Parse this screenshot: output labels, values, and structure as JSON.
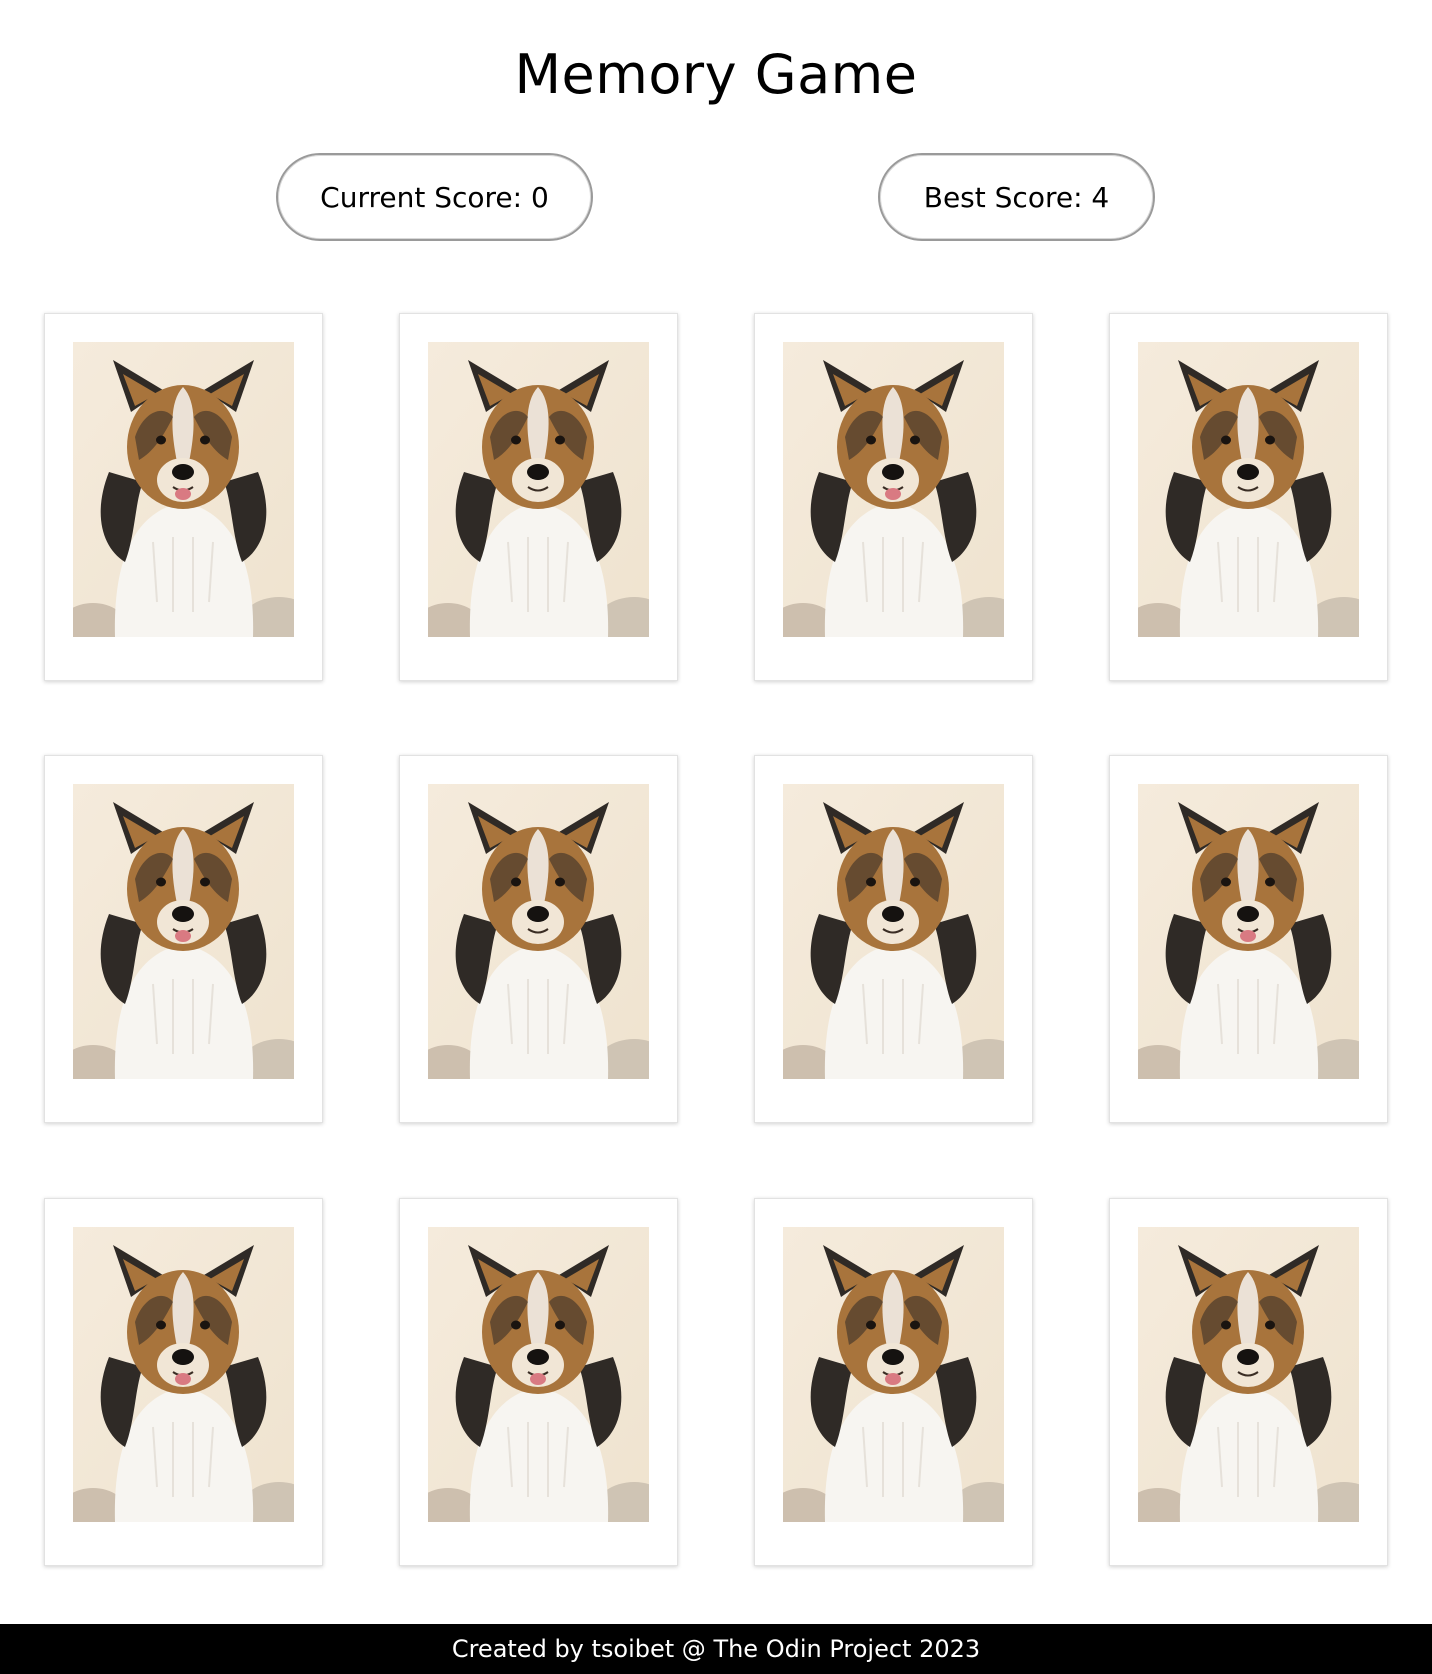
{
  "header": {
    "title": "Memory Game"
  },
  "scoreboard": {
    "current": "Current Score: 0",
    "best": "Best Score: 4"
  },
  "cards": [
    {
      "subject": "sheltie-dog-photo",
      "tongue": true
    },
    {
      "subject": "sheltie-dog-photo",
      "tongue": false
    },
    {
      "subject": "sheltie-dog-photo",
      "tongue": true
    },
    {
      "subject": "sheltie-dog-photo",
      "tongue": false
    },
    {
      "subject": "sheltie-dog-photo",
      "tongue": true
    },
    {
      "subject": "sheltie-dog-photo",
      "tongue": false
    },
    {
      "subject": "sheltie-dog-photo",
      "tongue": false
    },
    {
      "subject": "sheltie-dog-photo",
      "tongue": true
    },
    {
      "subject": "sheltie-dog-photo",
      "tongue": true
    },
    {
      "subject": "sheltie-dog-photo",
      "tongue": true
    },
    {
      "subject": "sheltie-dog-photo",
      "tongue": true
    },
    {
      "subject": "sheltie-dog-photo",
      "tongue": false
    }
  ],
  "footer": {
    "credit": "Created by tsoibet @ The Odin Project 2023"
  },
  "colors": {
    "background": "#ffffff",
    "footer_bg": "#000000",
    "footer_text": "#ffffff",
    "pill_border": "#9a9a9a",
    "photo_bg": "#efe3cf",
    "fur_tan": "#a8743c",
    "fur_dark": "#2f2a26",
    "fur_white": "#f7f5f1"
  }
}
